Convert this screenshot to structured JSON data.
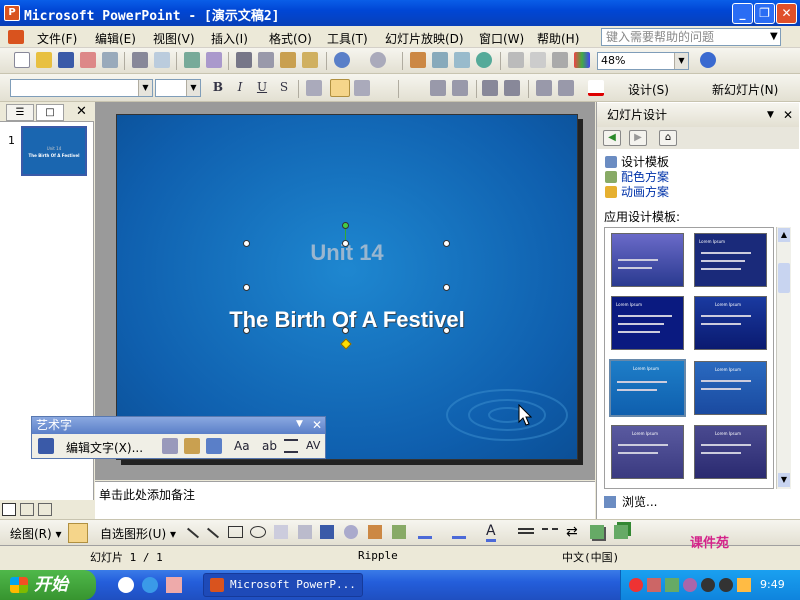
{
  "window": {
    "title": "Microsoft PowerPoint - [演示文稿2]",
    "app_icon": "P",
    "min_label": "_",
    "restore_label": "❐",
    "close_label": "✕"
  },
  "menu": {
    "items": [
      "文件(F)",
      "编辑(E)",
      "视图(V)",
      "插入(I)",
      "格式(O)",
      "工具(T)",
      "幻灯片放映(D)",
      "窗口(W)",
      "帮助(H)"
    ],
    "help_placeholder": "键入需要帮助的问题"
  },
  "standard_toolbar": {
    "zoom": "48%"
  },
  "format_toolbar": {
    "font_name": "",
    "font_size": "",
    "bold": "B",
    "italic": "I",
    "underline": "U",
    "shadow": "S",
    "design_label": "设计(S)",
    "new_slide_label": "新幻灯片(N)"
  },
  "left_pane": {
    "slide_number": "1"
  },
  "slide": {
    "title": "Unit 14",
    "subtitle": "The Birth Of A Festivel"
  },
  "notes": {
    "placeholder": "单击此处添加备注"
  },
  "wordart_toolbar": {
    "title": "艺术字",
    "edit_text": "编辑文字(X)...",
    "aa_label": "Aa",
    "ab_label": "ab",
    "av_label": "AV"
  },
  "task_pane": {
    "title": "幻灯片设计",
    "links": [
      "设计模板",
      "配色方案",
      "动画方案"
    ],
    "apply_label": "应用设计模板:",
    "template_title": "Lorem Ipsum",
    "browse": "浏览..."
  },
  "draw_toolbar": {
    "draw_label": "绘图(R)",
    "autoshape_label": "自选图形(U)"
  },
  "status": {
    "slide": "幻灯片 1 / 1",
    "theme": "Ripple",
    "language": "中文(中国)"
  },
  "taskbar": {
    "start": "开始",
    "task": "Microsoft PowerP...",
    "clock": "9:49"
  },
  "watermark": "课件苑",
  "colors": {
    "titlebar": "#0a5ee8",
    "slide_bg": "#1e87d0",
    "start_green": "#37942f"
  }
}
